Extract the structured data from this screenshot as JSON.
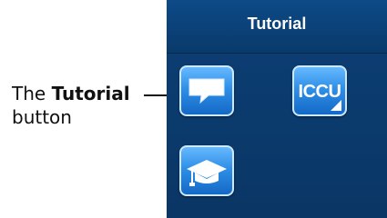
{
  "callout": {
    "prefix": "The",
    "emphasis": "Tutorial",
    "suffix": "button"
  },
  "panel": {
    "title": "Tutorial",
    "buttons": [
      {
        "name": "tutorial",
        "icon": "speech-bubble-icon"
      },
      {
        "name": "iccu",
        "label": "ICCU",
        "icon": "corner-triangle-icon"
      },
      {
        "name": "education",
        "icon": "graduation-cap-icon"
      }
    ]
  },
  "colors": {
    "panel_bg": "#0a3665",
    "tile_top": "#66b9ff",
    "tile_bottom": "#1469c6",
    "tile_border": "#cde8ff"
  }
}
